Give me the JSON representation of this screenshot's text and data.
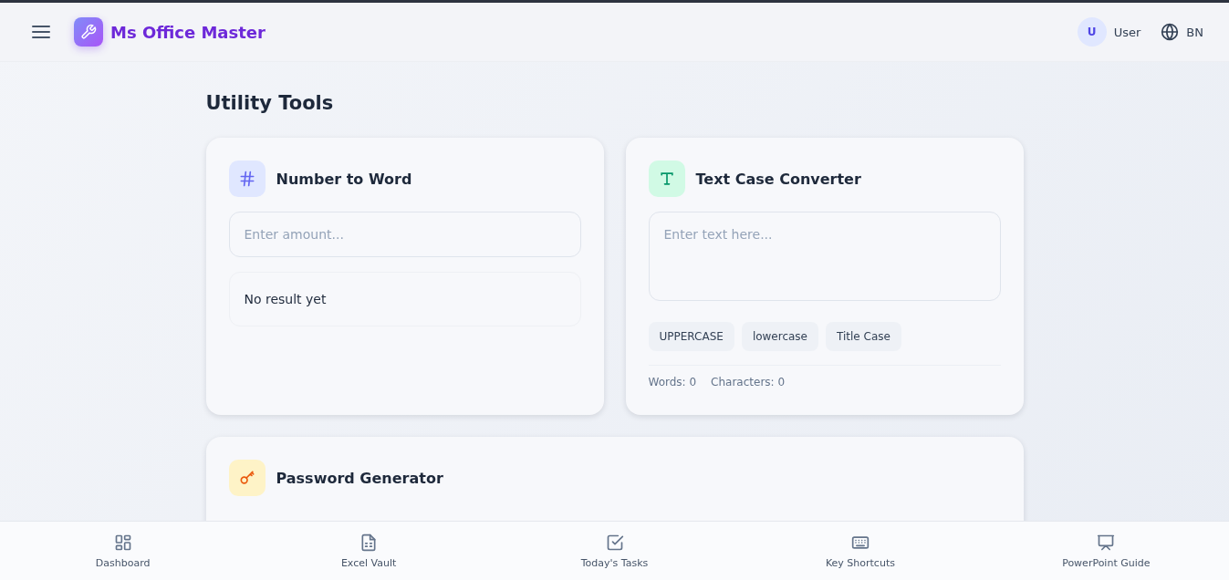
{
  "header": {
    "app_name": "Ms Office Master",
    "avatar_initial": "U",
    "user_label": "User",
    "language": "BN"
  },
  "page_title": "Utility Tools",
  "number_to_word": {
    "title": "Number to Word",
    "input": {
      "placeholder": "Enter amount..."
    },
    "result": "No result yet"
  },
  "text_case_converter": {
    "title": "Text Case Converter",
    "input": {
      "placeholder": "Enter text here..."
    },
    "buttons": [
      "UPPERCASE",
      "lowercase",
      "Title Case"
    ],
    "stats": [
      "Words: 0",
      "Characters: 0"
    ]
  },
  "password_generator": {
    "title": "Password Generator"
  },
  "bottom_nav": [
    {
      "kind": "dashboard",
      "label": "Dashboard"
    },
    {
      "kind": "excel",
      "label": "Excel Vault"
    },
    {
      "kind": "tasks",
      "label": "Today's Tasks"
    },
    {
      "kind": "keyboard",
      "label": "Key Shortcuts"
    },
    {
      "kind": "powerpoint",
      "label": "PowerPoint Guide"
    }
  ]
}
